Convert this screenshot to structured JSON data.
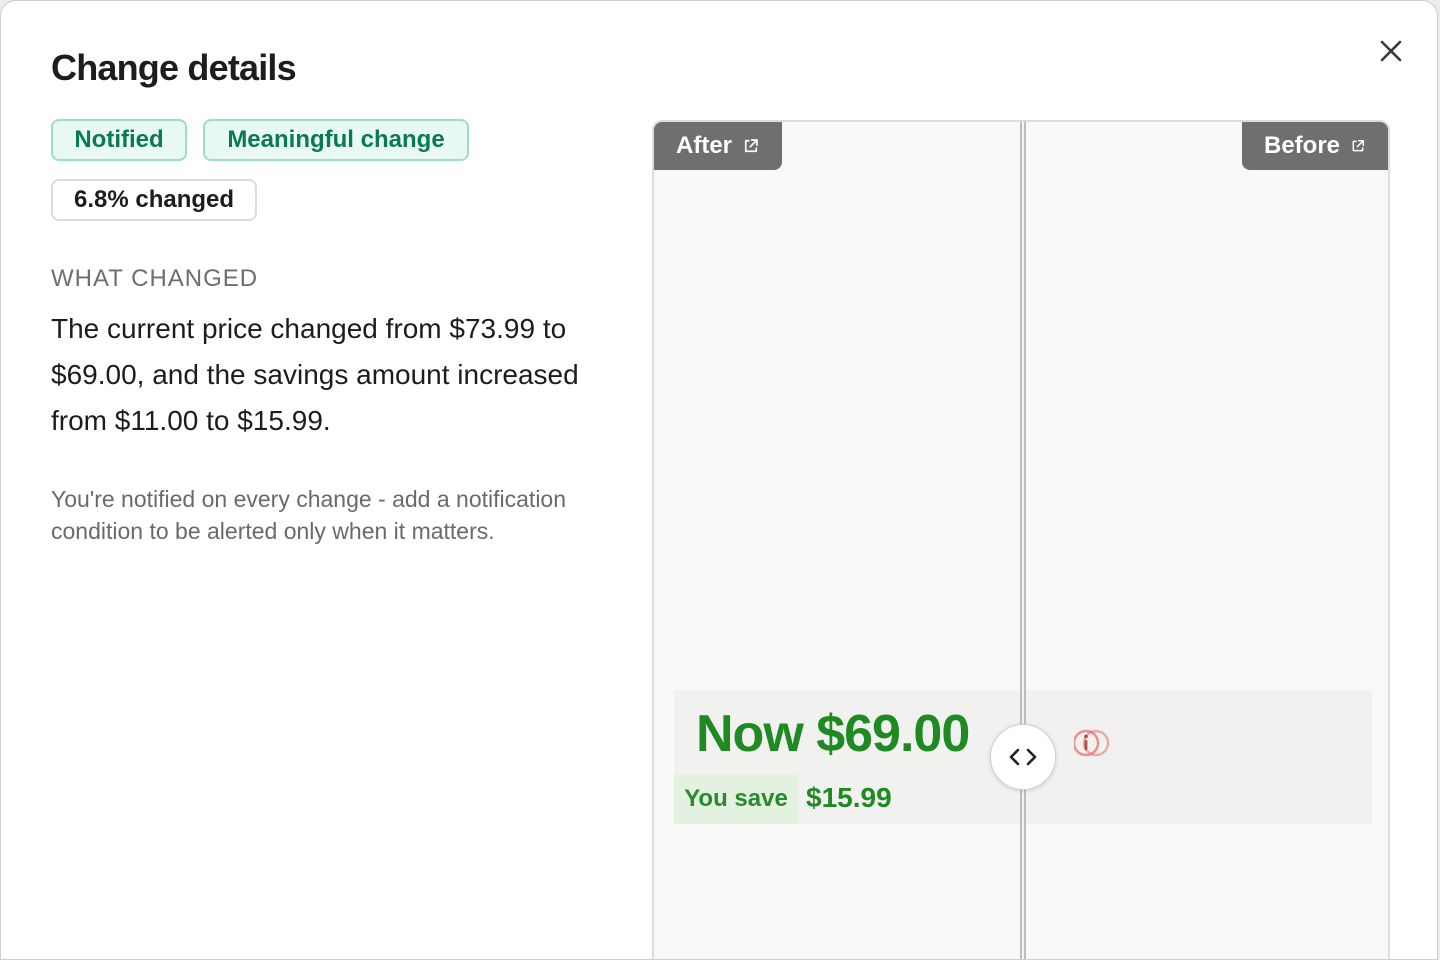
{
  "dialog": {
    "title": "Change details",
    "close_label": "Close",
    "badges": {
      "notified": "Notified",
      "meaningful": "Meaningful change",
      "changed": "6.8% changed"
    },
    "section_label": "WHAT CHANGED",
    "summary": "The current price changed from $73.99 to $69.00, and the savings amount increased from $11.00 to $15.99.",
    "notice": "You're notified on every change - add a notification condition to be alerted only when it matters."
  },
  "comparison": {
    "after_label": "After",
    "before_label": "Before",
    "after_content": {
      "now_label": "Now $69.00",
      "you_save_label": "You save",
      "save_amount": "$15.99"
    },
    "colors": {
      "price_green": "#1f8a22",
      "badge_green": "#0b7a50",
      "removed_red": "#e67878"
    },
    "icons": [
      "external-link-icon",
      "info-icon",
      "slider-handle-icon",
      "close-icon"
    ]
  }
}
